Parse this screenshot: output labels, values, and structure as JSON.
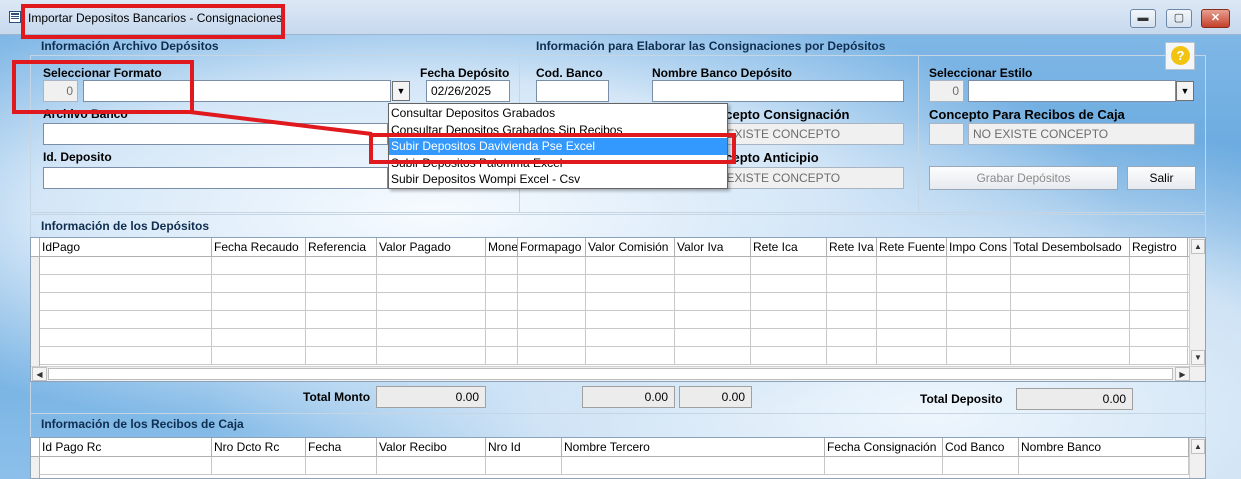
{
  "window": {
    "title": "Importar Depositos Bancarios - Consignaciones",
    "minimize_icon": "minimize-icon",
    "maximize_icon": "maximize-icon",
    "close_icon": "close-icon"
  },
  "info_archivo": {
    "section_title": "Información Archivo Depósitos",
    "seleccionar_formato_label": "Seleccionar Formato",
    "formato_code": "0",
    "formato_value": "",
    "fecha_deposito_label": "Fecha Depósito",
    "fecha_deposito_value": "02/26/2025",
    "archivo_banco_label": "Archivo Banco",
    "archivo_banco_value": "",
    "id_deposito_label": "Id. Deposito",
    "id_deposito_value": ""
  },
  "dropdown": {
    "items": [
      "Consultar Depositos Grabados",
      "Consultar Depositos Grabados Sin Recibos",
      "Subir Depositos Davivienda Pse Excel",
      "Subir Depositos Palomma Excel",
      "Subir Depositos Wompi Excel - Csv"
    ],
    "selected_index": 2
  },
  "info_consignaciones": {
    "section_title": "Información para Elaborar las Consignaciones por Depósitos",
    "cod_banco_label": "Cod. Banco",
    "cod_banco_value": "",
    "nombre_banco_label": "Nombre Banco Depósito",
    "nombre_banco_value": "",
    "concepto_consignacion_label": "Concepto Consignación",
    "concepto_consignacion_value": "NO EXISTE CONCEPTO",
    "concepto_anticipio_label": "Concepto Anticipio",
    "concepto_anticipio_value": "NO EXISTE CONCEPTO"
  },
  "estilo": {
    "seleccionar_estilo_label": "Seleccionar Estilo",
    "estilo_code": "0",
    "estilo_value": "",
    "concepto_recibos_label": "Concepto Para Recibos de Caja",
    "concepto_recibos_code": "",
    "concepto_recibos_value": "NO EXISTE CONCEPTO",
    "grabar_label": "Grabar Depósitos",
    "salir_label": "Salir",
    "help_icon": "help-icon"
  },
  "depositos": {
    "section_title": "Información de los Depósitos",
    "columns": [
      "IdPago",
      "Fecha Recaudo",
      "Referencia",
      "Valor Pagado",
      "Mone",
      "Formapago",
      "Valor Comisión",
      "Valor Iva",
      "Rete Ica",
      "Rete Iva",
      "Rete Fuente",
      "Impo Cons",
      "Total Desembolsado",
      "Registro"
    ],
    "total_monto_label": "Total Monto",
    "total_monto_value": "0.00",
    "total_comision_value": "0.00",
    "total_iva_value": "0.00",
    "total_deposito_label": "Total Deposito",
    "total_deposito_value": "0.00"
  },
  "recibos": {
    "section_title": "Información de los Recibos de Caja",
    "columns": [
      "Id Pago Rc",
      "Nro Dcto Rc",
      "Fecha",
      "Valor Recibo",
      "Nro Id",
      "Nombre Tercero",
      "Fecha Consignación",
      "Cod Banco",
      "Nombre Banco"
    ]
  }
}
